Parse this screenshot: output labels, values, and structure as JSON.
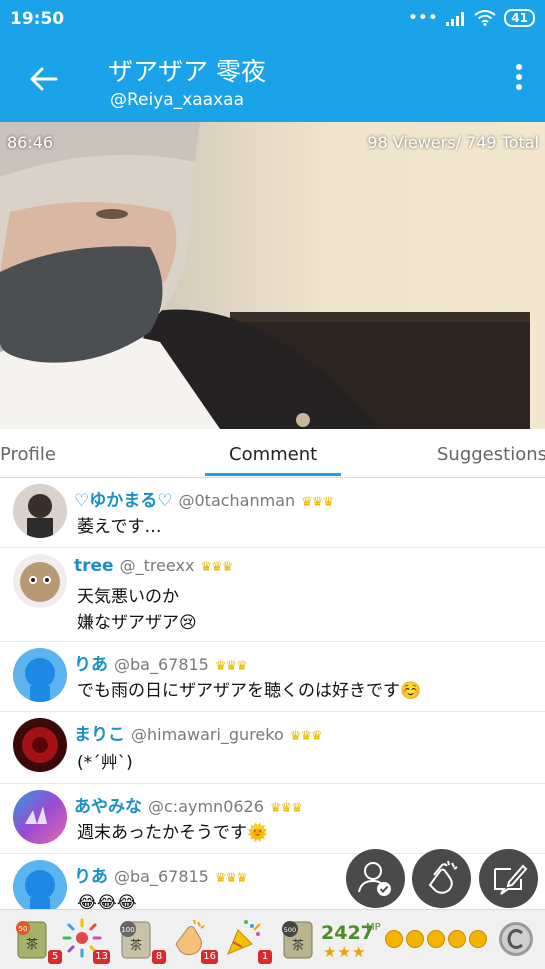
{
  "status_bar": {
    "time": "19:50",
    "battery": "41"
  },
  "app_bar": {
    "title": "ザアザア 零夜",
    "handle": "@Reiya_xaaxaa"
  },
  "video": {
    "timer": "86:46",
    "viewers": "98 Viewers/ 749 Total"
  },
  "tabs": [
    {
      "label": "Profile"
    },
    {
      "label": "Comment"
    },
    {
      "label": "Suggestions"
    }
  ],
  "comments": [
    {
      "name": "♡ゆかまる♡",
      "id": "@0tachanman",
      "lines": [
        "萎えです…"
      ]
    },
    {
      "name": "tree",
      "id": "@_treexx",
      "lines": [
        "天気悪いのか",
        "嫌なザアザア😢"
      ]
    },
    {
      "name": "りあ",
      "id": "@ba_67815",
      "lines": [
        "でも雨の日にザアザアを聴くのは好きです☺️"
      ]
    },
    {
      "name": "まりこ",
      "id": "@himawari_gureko",
      "lines": [
        "(*´艸`)"
      ]
    },
    {
      "name": "あやみな",
      "id": "@c:aymn0626",
      "lines": [
        "週末あったかそうです🌞"
      ]
    },
    {
      "name": "りあ",
      "id": "@ba_67815",
      "lines": [
        "😂😂😂"
      ]
    }
  ],
  "gifts": [
    {
      "name": "tea-50",
      "badge": "5"
    },
    {
      "name": "firework",
      "badge": "13"
    },
    {
      "name": "tea-100",
      "badge": "8"
    },
    {
      "name": "clap",
      "badge": "16"
    },
    {
      "name": "party-popper",
      "badge": "1"
    },
    {
      "name": "tea-500",
      "badge": ""
    }
  ],
  "gift_labels": {
    "tea_50": "50",
    "tea_50_kanji": "茶",
    "tea_100": "100",
    "tea_100_kanji": "茶",
    "tea_500": "500",
    "tea_500_kanji": "茶"
  },
  "mp": {
    "value": "2427",
    "unit": "MP",
    "stars": "★★★"
  },
  "colors": {
    "accent": "#1aa3e8",
    "name": "#1b8fcb",
    "mp_green": "#4c8d2a"
  }
}
